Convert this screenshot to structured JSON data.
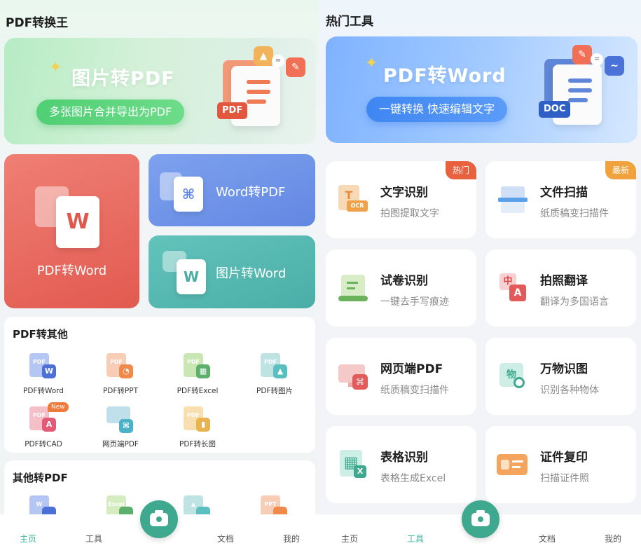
{
  "left": {
    "app_title": "PDF转换王",
    "banner": {
      "title": "图片转PDF",
      "subtitle": "多张图片合并导出为PDF",
      "doc_tag": "PDF"
    },
    "tiles": {
      "pdf_to_word": {
        "label": "PDF转Word"
      },
      "word_to_pdf": {
        "label": "Word转PDF"
      },
      "image_to_word": {
        "label": "图片转Word"
      }
    },
    "pdf_to_other": {
      "title": "PDF转其他",
      "items": [
        {
          "label": "PDF转Word"
        },
        {
          "label": "PDF转PPT"
        },
        {
          "label": "PDF转Excel"
        },
        {
          "label": "PDF转图片"
        },
        {
          "label": "PDF转CAD",
          "badge": "New"
        },
        {
          "label": "网页端PDF"
        },
        {
          "label": "PDF转长图"
        }
      ]
    },
    "other_to_pdf": {
      "title": "其他转PDF"
    },
    "nav": {
      "home": "主页",
      "tools": "工具",
      "docs": "文档",
      "mine": "我的"
    }
  },
  "right": {
    "section_title": "热门工具",
    "banner": {
      "title": "PDF转Word",
      "subtitle": "一键转换 快速编辑文字",
      "doc_tag": "DOC"
    },
    "tools": [
      {
        "name": "文字识别",
        "desc": "拍图提取文字",
        "badge": "热门"
      },
      {
        "name": "文件扫描",
        "desc": "纸质稿变扫描件",
        "badge": "最新"
      },
      {
        "name": "试卷识别",
        "desc": "一键去手写痕迹"
      },
      {
        "name": "拍照翻译",
        "desc": "翻译为多国语言"
      },
      {
        "name": "网页端PDF",
        "desc": "纸质稿变扫描件"
      },
      {
        "name": "万物识图",
        "desc": "识别各种物体"
      },
      {
        "name": "表格识别",
        "desc": "表格生成Excel"
      },
      {
        "name": "证件复印",
        "desc": "扫描证件照"
      }
    ],
    "nav": {
      "home": "主页",
      "tools": "工具",
      "docs": "文档",
      "mine": "我的"
    }
  },
  "colors": {
    "accent_green": "#3fa98f",
    "hot_badge": "#e8623f",
    "new_badge": "#f0a23c",
    "tile_red": "#e25a50",
    "tile_blue": "#6287e2",
    "tile_teal": "#4aaea7"
  },
  "icons": {
    "sparkle": "✦",
    "pdf": "acrobat-icon",
    "camera": "camera-icon"
  }
}
